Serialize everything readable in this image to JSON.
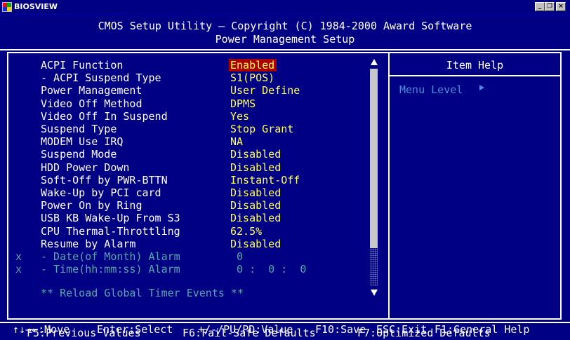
{
  "window": {
    "title": "BIOSVIEW",
    "minimize_glyph": "_",
    "restore_glyph": "❐",
    "close_glyph": "×"
  },
  "header": {
    "line1": "CMOS Setup Utility – Copyright (C) 1984-2000 Award Software",
    "line2": "Power Management Setup"
  },
  "settings": [
    {
      "label": "ACPI Function",
      "value": "Enabled",
      "selected": true,
      "disabled": false
    },
    {
      "label": "- ACPI Suspend Type",
      "value": "S1(POS)",
      "selected": false,
      "disabled": false
    },
    {
      "label": "Power Management",
      "value": "User Define",
      "selected": false,
      "disabled": false
    },
    {
      "label": "Video Off Method",
      "value": "DPMS",
      "selected": false,
      "disabled": false
    },
    {
      "label": "Video Off In Suspend",
      "value": "Yes",
      "selected": false,
      "disabled": false
    },
    {
      "label": "Suspend Type",
      "value": "Stop Grant",
      "selected": false,
      "disabled": false
    },
    {
      "label": "MODEM Use IRQ",
      "value": "NA",
      "selected": false,
      "disabled": false
    },
    {
      "label": "Suspend Mode",
      "value": "Disabled",
      "selected": false,
      "disabled": false
    },
    {
      "label": "HDD Power Down",
      "value": "Disabled",
      "selected": false,
      "disabled": false
    },
    {
      "label": "Soft-Off by PWR-BTTN",
      "value": "Instant-Off",
      "selected": false,
      "disabled": false
    },
    {
      "label": "Wake-Up by PCI card",
      "value": "Disabled",
      "selected": false,
      "disabled": false
    },
    {
      "label": "Power On by Ring",
      "value": "Disabled",
      "selected": false,
      "disabled": false
    },
    {
      "label": "USB KB Wake-Up From S3",
      "value": "Disabled",
      "selected": false,
      "disabled": false
    },
    {
      "label": "CPU Thermal-Throttling",
      "value": "62.5%",
      "selected": false,
      "disabled": false
    },
    {
      "label": "Resume by Alarm",
      "value": "Disabled",
      "selected": false,
      "disabled": false
    },
    {
      "label": "- Date(of Month) Alarm",
      "value": " 0",
      "selected": false,
      "disabled": true
    },
    {
      "label": "- Time(hh:mm:ss) Alarm",
      "value": " 0 :  0 :  0",
      "selected": false,
      "disabled": true
    }
  ],
  "disabled_marker": "x",
  "reload_text": "** Reload Global Timer Events **",
  "help": {
    "title": "Item Help",
    "menu_level": "Menu Level"
  },
  "footer": {
    "keys_row1": [
      {
        "key": "↑↓→←:Move"
      },
      {
        "key": "Enter:Select"
      },
      {
        "key": "+/-/PU/PD:Value"
      },
      {
        "key": "F10:Save"
      },
      {
        "key": "ESC:Exit"
      },
      {
        "key": "F1:General Help"
      }
    ],
    "keys_row2": [
      {
        "key": "F5:Previous Values"
      },
      {
        "key": "F6:Fail-Safe Defaults"
      },
      {
        "key": "F7:Optimized Defaults"
      }
    ]
  },
  "colors": {
    "background": "#000084",
    "label": "#ffffff",
    "value": "#ffff54",
    "selected_bg": "#a80000",
    "disabled": "#54a8a8",
    "help_text": "#4a8ce0"
  }
}
